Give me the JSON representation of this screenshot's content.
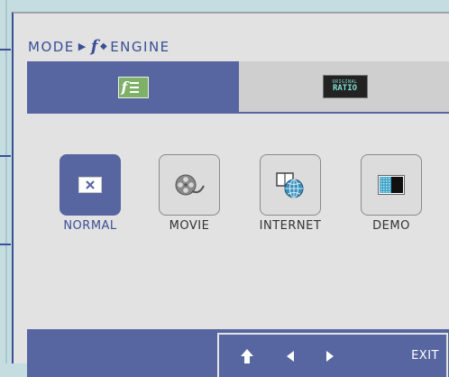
{
  "header": {
    "mode_word": "MODE",
    "f_char": "f",
    "engine_word": "ENGINE"
  },
  "tabs": [
    {
      "icon": "f-engine-icon",
      "active": true
    },
    {
      "icon": "original-ratio-icon",
      "active": false,
      "line1": "ORIGINAL",
      "line2": "RATIO"
    }
  ],
  "modes": [
    {
      "label": "NORMAL",
      "icon": "normal-mode-icon",
      "selected": true
    },
    {
      "label": "MOVIE",
      "icon": "movie-reel-icon",
      "selected": false
    },
    {
      "label": "INTERNET",
      "icon": "internet-globe-icon",
      "selected": false
    },
    {
      "label": "DEMO",
      "icon": "demo-split-screen-icon",
      "selected": false
    }
  ],
  "footer": {
    "exit_label": "EXIT",
    "buttons": [
      "up-arrow-icon",
      "left-arrow-icon",
      "right-arrow-icon"
    ]
  },
  "colors": {
    "accent": "#5766a0",
    "panel": "#e2e2e2",
    "background": "#c5dde0"
  }
}
